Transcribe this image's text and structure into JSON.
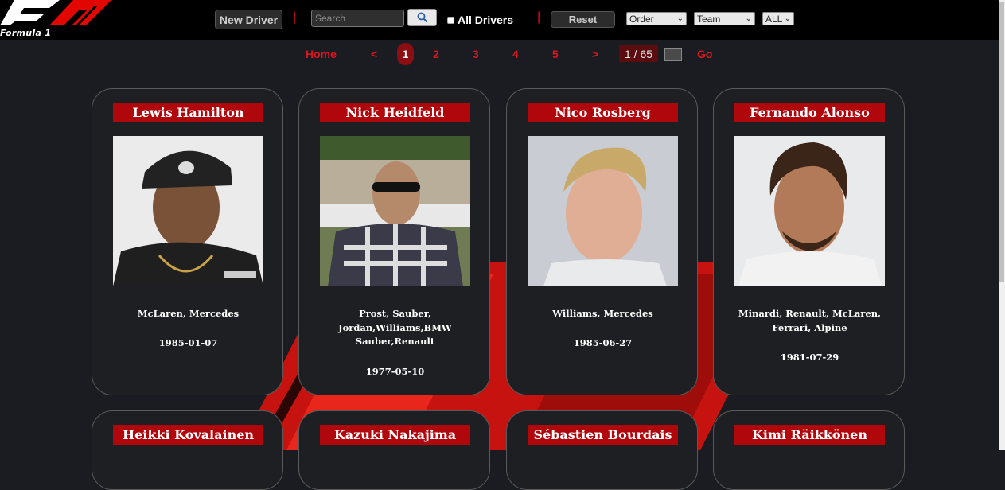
{
  "brand": {
    "logo_text": "Formula 1"
  },
  "toolbar": {
    "new_driver_label": "New Driver",
    "separator": "|",
    "search_placeholder": "Search",
    "search_value": "",
    "search_icon": "search-icon",
    "all_drivers_label": "All Drivers",
    "all_drivers_checked": false,
    "reset_label": "Reset",
    "order_select": "Order",
    "team_select": "Team",
    "all_select": "ALL"
  },
  "pagination": {
    "home_label": "Home",
    "prev_label": "<",
    "pages": [
      "1",
      "2",
      "3",
      "4",
      "5"
    ],
    "current_page": "1",
    "next_label": ">",
    "page_count": "1 / 65",
    "go_label": "Go"
  },
  "drivers": [
    {
      "name": "Lewis Hamilton",
      "teams": "McLaren, Mercedes",
      "dob": "1985-01-07"
    },
    {
      "name": "Nick Heidfeld",
      "teams": "Prost, Sauber, Jordan,Williams,BMW Sauber,Renault",
      "dob": "1977-05-10"
    },
    {
      "name": "Nico Rosberg",
      "teams": "Williams, Mercedes",
      "dob": "1985-06-27"
    },
    {
      "name": "Fernando Alonso",
      "teams": "Minardi, Renault, McLaren, Ferrari, Alpine",
      "dob": "1981-07-29"
    },
    {
      "name": "Heikki Kovalainen"
    },
    {
      "name": "Kazuki Nakajima"
    },
    {
      "name": "Sébastien Bourdais"
    },
    {
      "name": "Kimi Räikkönen"
    }
  ],
  "colors": {
    "accent_red": "#d9161f",
    "card_title_bg": "#b0070c",
    "page_bg": "#1b1c22"
  }
}
